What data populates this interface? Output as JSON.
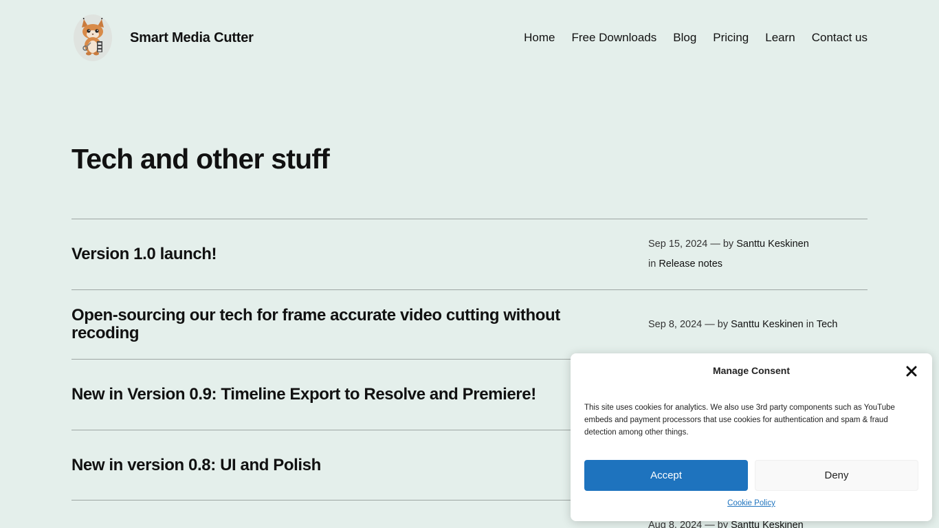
{
  "header": {
    "site_title": "Smart Media Cutter",
    "nav": [
      "Home",
      "Free Downloads",
      "Blog",
      "Pricing",
      "Learn",
      "Contact us"
    ]
  },
  "page_title": "Tech and other stuff",
  "posts": [
    {
      "title": "Version 1.0 launch!",
      "date": "Sep 15, 2024",
      "sep": "—",
      "by": "by",
      "author": "Santtu Keskinen",
      "in": "in",
      "category": "Release notes"
    },
    {
      "title": "Open-sourcing our tech for frame accurate video cutting without recoding",
      "date": "Sep 8, 2024",
      "sep": "—",
      "by": "by",
      "author": "Santtu Keskinen",
      "in": "in",
      "category": "Tech"
    },
    {
      "title": "New in Version 0.9: Timeline Export to Resolve and Premiere!",
      "date": "",
      "sep": "",
      "by": "",
      "author": "",
      "in": "",
      "category": ""
    },
    {
      "title": "New in version 0.8: UI and Polish",
      "date": "",
      "sep": "",
      "by": "",
      "author": "",
      "in": "",
      "category": ""
    },
    {
      "title": "",
      "date": "Aug 8, 2024",
      "sep": "—",
      "by": "by",
      "author": "Santtu Keskinen",
      "in": "",
      "category": ""
    }
  ],
  "consent": {
    "title": "Manage Consent",
    "text": "This site uses cookies for analytics. We also use 3rd party components such as YouTube embeds and payment processors that use cookies for authentication and spam & fraud detection among other things.",
    "accept_label": "Accept",
    "deny_label": "Deny",
    "policy_label": "Cookie Policy"
  },
  "colors": {
    "background": "#e4efeb",
    "accent": "#1e73be"
  },
  "icons": {
    "logo": "lynx-mascot-icon",
    "close": "close-icon"
  }
}
